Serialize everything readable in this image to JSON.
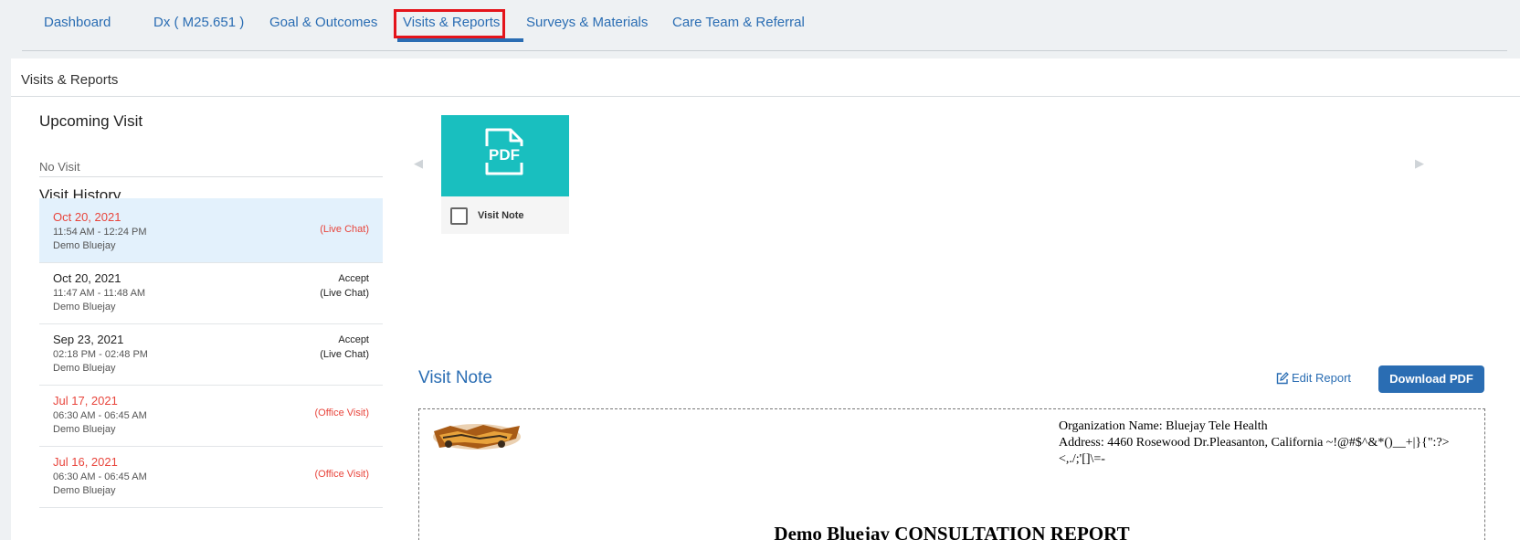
{
  "tabs": [
    {
      "label": "Dashboard"
    },
    {
      "label": "Dx ( M25.651 )"
    },
    {
      "label": "Goal & Outcomes"
    },
    {
      "label": "Visits & Reports"
    },
    {
      "label": "Surveys & Materials"
    },
    {
      "label": "Care Team & Referral"
    }
  ],
  "active_tab": "Visits & Reports",
  "panel": {
    "title": "Visits & Reports"
  },
  "upcoming": {
    "title": "Upcoming Visit",
    "empty_text": "No Visit"
  },
  "history": {
    "title": "Visit History",
    "visits": [
      {
        "date": "Oct 20, 2021",
        "time": "11:54 AM - 12:24 PM",
        "provider": "Demo Bluejay",
        "status_top": "",
        "status": "(Live Chat)",
        "color": "red",
        "selected": true
      },
      {
        "date": "Oct 20, 2021",
        "time": "11:47 AM - 11:48 AM",
        "provider": "Demo Bluejay",
        "status_top": "Accept",
        "status": "(Live Chat)",
        "color": "normal",
        "selected": false
      },
      {
        "date": "Sep 23, 2021",
        "time": "02:18 PM - 02:48 PM",
        "provider": "Demo Bluejay",
        "status_top": "Accept",
        "status": "(Live Chat)",
        "color": "normal",
        "selected": false
      },
      {
        "date": "Jul 17, 2021",
        "time": "06:30 AM - 06:45 AM",
        "provider": "Demo Bluejay",
        "status_top": "",
        "status": "(Office Visit)",
        "color": "red",
        "selected": false
      },
      {
        "date": "Jul 16, 2021",
        "time": "06:30 AM - 06:45 AM",
        "provider": "Demo Bluejay",
        "status_top": "",
        "status": "(Office Visit)",
        "color": "red",
        "selected": false
      }
    ]
  },
  "documents": [
    {
      "label": "Visit Note",
      "icon": "pdf-file-icon",
      "icon_text": "PDF",
      "checked": false
    }
  ],
  "note": {
    "title": "Visit Note",
    "edit_label": "Edit Report",
    "download_label": "Download PDF"
  },
  "report": {
    "org_name": "Organization Name: Bluejay Tele Health",
    "address": "Address: 4460 Rosewood Dr.Pleasanton, California ~!@#$^&*()__+|}{\":?><,./;'[]\\=-",
    "title": "Demo Bluejay CONSULTATION REPORT"
  },
  "colors": {
    "accent": "#2a6db3",
    "highlight_box": "#e4141b",
    "thumb": "#19bfbf",
    "status_red": "#e8453c",
    "selected_row": "#e3f1fc"
  }
}
